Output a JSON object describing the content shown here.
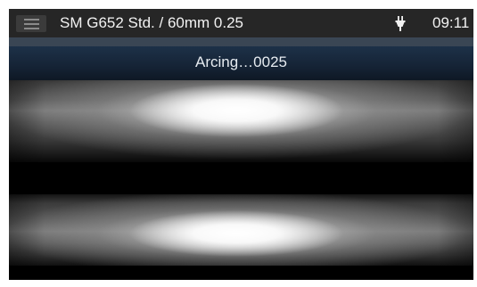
{
  "statusbar": {
    "menu_icon": "hamburger-menu-icon",
    "title": "SM G652 Std. / 60mm 0.25",
    "power_icon": "ac-power-plug-icon",
    "time": "09:11"
  },
  "message": {
    "text": "Arcing…0025",
    "background_color": "#1b2d42"
  },
  "camera_views": [
    {
      "name": "upper-camera-view"
    },
    {
      "name": "lower-camera-view"
    }
  ],
  "colors": {
    "statusbar_bg": "#262626",
    "separator_bg": "#3a4654",
    "screen_bg": "#050505"
  }
}
